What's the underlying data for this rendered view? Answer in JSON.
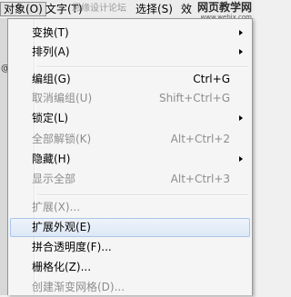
{
  "menubar": {
    "items": [
      {
        "label": "对象(O)",
        "active": true
      },
      {
        "label": "文字(T)"
      },
      {
        "label": "选择(S)"
      },
      {
        "label": "效"
      }
    ],
    "hint": "思缘设计论坛"
  },
  "watermark": {
    "title": "网页教学网",
    "url": "www.webjx.com"
  },
  "background": {
    "strip_text": "@"
  },
  "menu": {
    "group_obj": {
      "transform": "变换(T)",
      "arrange": "排列(A)"
    },
    "group_edit": {
      "group": {
        "label": "编组(G)",
        "shortcut": "Ctrl+G"
      },
      "ungroup": {
        "label": "取消编组(U)",
        "shortcut": "Shift+Ctrl+G"
      },
      "lock": {
        "label": "锁定(L)"
      },
      "unlock_all": {
        "label": "全部解锁(K)",
        "shortcut": "Alt+Ctrl+2"
      },
      "hide": {
        "label": "隐藏(H)"
      },
      "show_all": {
        "label": "显示全部",
        "shortcut": "Alt+Ctrl+3"
      }
    },
    "group_expand": {
      "expand": "扩展(X)...",
      "expand_appearance": "扩展外观(E)",
      "flatten_transparency": "拼合透明度(F)...",
      "rasterize": "栅格化(Z)...",
      "create_gradient_mesh": "创建渐变网格(D)..."
    }
  },
  "colors": {
    "highlight_border": "#aac5e9",
    "disabled_text": "#8d8d8d",
    "menu_bg": "#f5f5f5"
  }
}
